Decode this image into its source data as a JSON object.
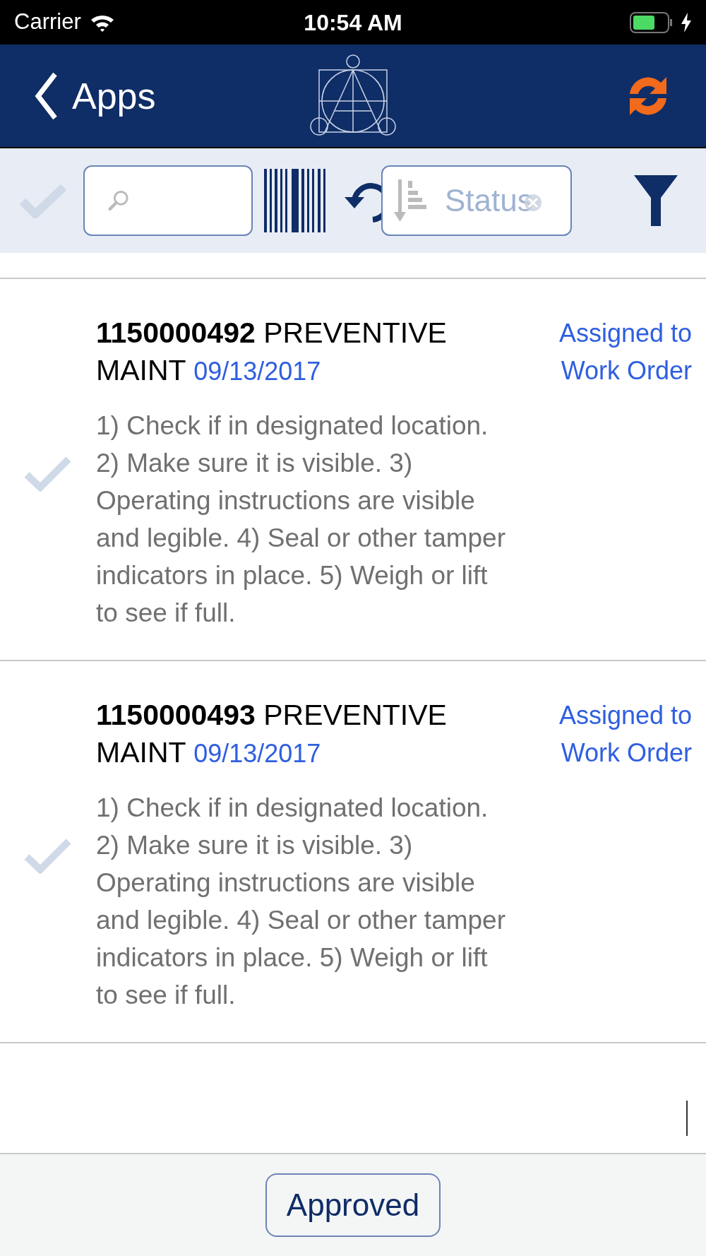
{
  "status_bar": {
    "carrier": "Carrier",
    "time": "10:54 AM"
  },
  "nav": {
    "back_label": "Apps"
  },
  "toolbar": {
    "select_all_checked": false,
    "sort": {
      "value": "Status"
    }
  },
  "items": [
    {
      "number": "1150000492",
      "type": "PREVENTIVE MAINT",
      "date": "09/13/2017",
      "status": "Assigned to Work Order",
      "description": "1) Check if in designated location. 2) Make sure it is visible. 3) Operating instructions are visible and legible. 4) Seal or other tamper indicators in place. 5) Weigh or lift to see if full.",
      "checked": false
    },
    {
      "number": "1150000493",
      "type": "PREVENTIVE MAINT",
      "date": "09/13/2017",
      "status": "Assigned to Work Order",
      "description": "1) Check if in designated location. 2) Make sure it is visible. 3) Operating instructions are visible and legible. 4) Seal or other tamper indicators in place. 5) Weigh or lift to see if full.",
      "checked": false
    }
  ],
  "footer": {
    "button": "Approved"
  }
}
